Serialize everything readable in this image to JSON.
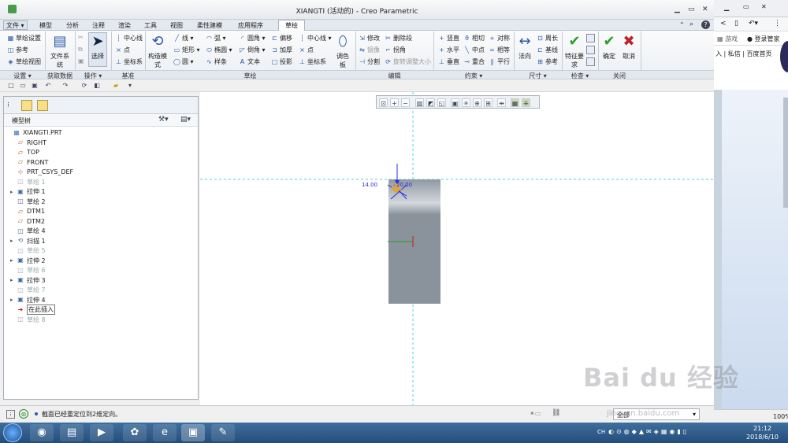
{
  "window": {
    "title": "XIANGTI (活动的) - Creo Parametric"
  },
  "tabs": [
    {
      "label": "文件"
    },
    {
      "label": "模型"
    },
    {
      "label": "分析"
    },
    {
      "label": "注释"
    },
    {
      "label": "渲染"
    },
    {
      "label": "工具"
    },
    {
      "label": "视图"
    },
    {
      "label": "柔性建模"
    },
    {
      "label": "应用程序"
    },
    {
      "label": "草绘"
    }
  ],
  "ribbon": {
    "setup": {
      "sketch_setup": "草绘设置",
      "reference": "参考",
      "sketch_view": "草绘视图",
      "label": "设置"
    },
    "getdata": {
      "file_system": "文件系统",
      "label": "获取数据"
    },
    "ops": {
      "select": "选择",
      "label": "操作"
    },
    "datum": {
      "centerline": "中心线",
      "point": "点",
      "csys": "坐标系",
      "label": "基准"
    },
    "sketch": {
      "construction_mode": "构造模式",
      "line": "线",
      "rectangle": "矩形",
      "circle": "圆",
      "arc": "弧",
      "ellipse": "椭圆",
      "spline": "样条",
      "fillet": "圆角",
      "chamfer": "倒角",
      "text": "文本",
      "offset": "偏移",
      "thicken": "加厚",
      "project": "投影",
      "centerline": "中心线",
      "point": "点",
      "csys": "坐标系",
      "palette": "调色板",
      "label": "草绘"
    },
    "edit": {
      "modify": "修改",
      "mirror": "镜像",
      "divide": "分割",
      "delete_segment": "删除段",
      "corner": "拐角",
      "rotate_resize": "旋转调整大小",
      "label": "编辑"
    },
    "constrain": {
      "vertical": "竖直",
      "horizontal": "水平",
      "perpendicular": "垂直",
      "tangent": "相切",
      "midpoint": "中点",
      "coincident": "重合",
      "symmetric": "对称",
      "equal": "相等",
      "parallel": "平行",
      "label": "约束"
    },
    "dimension": {
      "normal": "法向",
      "perimeter": "周长",
      "baseline": "基线",
      "reference": "参考",
      "label": "尺寸"
    },
    "inspect": {
      "feature_req": "特征要求",
      "label": "检查"
    },
    "close": {
      "ok": "确定",
      "cancel": "取消",
      "label": "关闭"
    }
  },
  "tree": {
    "title": "模型树",
    "items": [
      {
        "label": "XIANGTI.PRT",
        "icon": "part-icon",
        "dim": false,
        "expand": false
      },
      {
        "label": "RIGHT",
        "icon": "datum-plane-icon",
        "dim": false,
        "expand": false
      },
      {
        "label": "TOP",
        "icon": "datum-plane-icon",
        "dim": false,
        "expand": false
      },
      {
        "label": "FRONT",
        "icon": "datum-plane-icon",
        "dim": false,
        "expand": false
      },
      {
        "label": "PRT_CSYS_DEF",
        "icon": "csys-icon",
        "dim": false,
        "expand": false
      },
      {
        "label": "草绘 1",
        "icon": "sketch-icon",
        "dim": true,
        "expand": false
      },
      {
        "label": "拉伸 1",
        "icon": "extrude-icon",
        "dim": false,
        "expand": true
      },
      {
        "label": "草绘 2",
        "icon": "sketch-icon",
        "dim": false,
        "expand": false
      },
      {
        "label": "DTM1",
        "icon": "datum-plane-icon",
        "dim": false,
        "expand": false
      },
      {
        "label": "DTM2",
        "icon": "datum-plane-icon",
        "dim": false,
        "expand": false
      },
      {
        "label": "草绘 4",
        "icon": "sketch-icon",
        "dim": false,
        "expand": false
      },
      {
        "label": "扫描 1",
        "icon": "sweep-icon",
        "dim": false,
        "expand": true
      },
      {
        "label": "草绘 5",
        "icon": "sketch-icon",
        "dim": true,
        "expand": false
      },
      {
        "label": "拉伸 2",
        "icon": "extrude-icon",
        "dim": false,
        "expand": true
      },
      {
        "label": "草绘 6",
        "icon": "sketch-icon",
        "dim": true,
        "expand": false
      },
      {
        "label": "拉伸 3",
        "icon": "extrude-icon",
        "dim": false,
        "expand": true
      },
      {
        "label": "草绘 7",
        "icon": "sketch-icon",
        "dim": true,
        "expand": false
      },
      {
        "label": "拉伸 4",
        "icon": "extrude-icon",
        "dim": false,
        "expand": true
      },
      {
        "label": "在此插入",
        "icon": "insert-arrow-icon",
        "dim": false,
        "expand": false
      },
      {
        "label": "草绘 8",
        "icon": "sketch-icon",
        "dim": true,
        "expand": false
      }
    ]
  },
  "viewport": {
    "dim1": "14.00",
    "dim2": "20.00"
  },
  "status": {
    "message": "截面已经重定位到2维定向。",
    "filter": "全部"
  },
  "side": {
    "game": "游戏",
    "login": "登录管家",
    "links": "入 | 私信 | 百度首页"
  },
  "taskbar": {
    "lang": "CH",
    "time": "21:12",
    "date": "2018/6/10"
  },
  "watermark": {
    "brand": "Bai du 经验",
    "url": "jingyan.baidu.com"
  },
  "zoom": "100%",
  "colors": {
    "accent": "#2a5aa8",
    "ok": "#2aa02a",
    "cancel": "#c0202a",
    "part": "#8a929b"
  }
}
